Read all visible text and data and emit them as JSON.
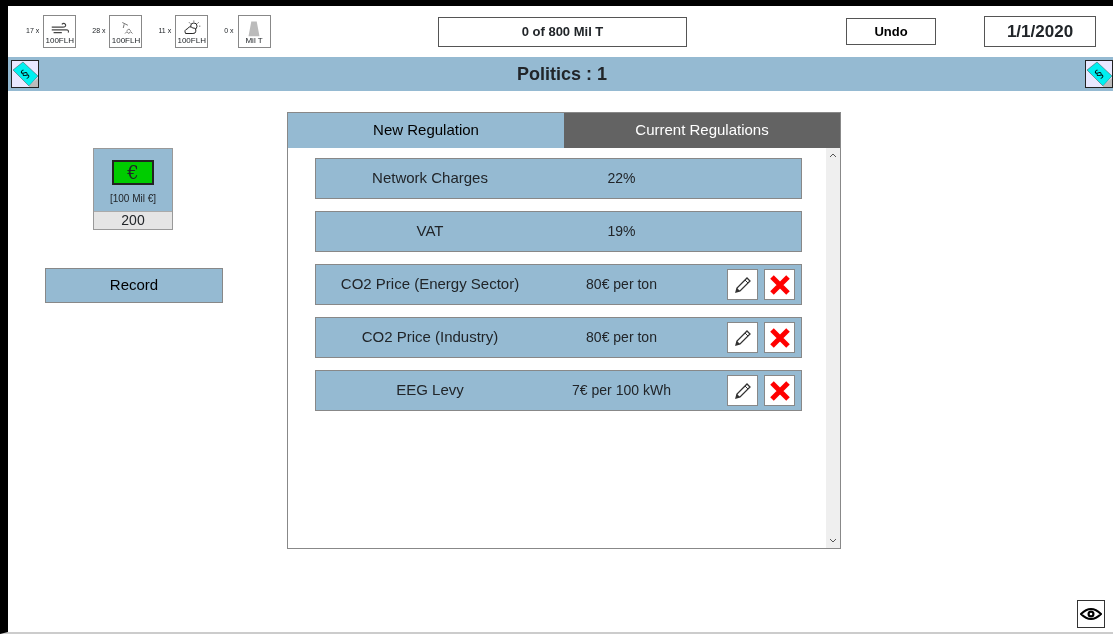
{
  "resources": [
    {
      "count": "17 x",
      "label": "100FLH",
      "kind": "wind"
    },
    {
      "count": "28 x",
      "label": "100FLH",
      "kind": "hydro"
    },
    {
      "count": "11 x",
      "label": "100FLH",
      "kind": "solar"
    },
    {
      "count": "0 x",
      "label": "Mil T",
      "kind": "storage"
    }
  ],
  "emissions": "0 of 800 Mil T",
  "undo": "Undo",
  "date": "1/1/2020",
  "title_bar": {
    "title": "Politics : 1",
    "left_symbol": "§",
    "right_symbol": "§"
  },
  "budget": {
    "unit": "[100 Mil €]",
    "value": "200",
    "symbol": "€"
  },
  "record": "Record",
  "tabs": [
    {
      "label": "New Regulation",
      "selected": true
    },
    {
      "label": "Current Regulations",
      "selected": false
    }
  ],
  "regulations": [
    {
      "name": "Network Charges",
      "value": "22%",
      "editable": false
    },
    {
      "name": "VAT",
      "value": "19%",
      "editable": false
    },
    {
      "name": "CO2 Price (Energy Sector)",
      "value": "80€ per ton",
      "editable": true
    },
    {
      "name": "CO2 Price (Industry)",
      "value": "80€ per ton",
      "editable": true
    },
    {
      "name": "EEG Levy",
      "value": "7€ per 100 kWh",
      "editable": true
    }
  ]
}
